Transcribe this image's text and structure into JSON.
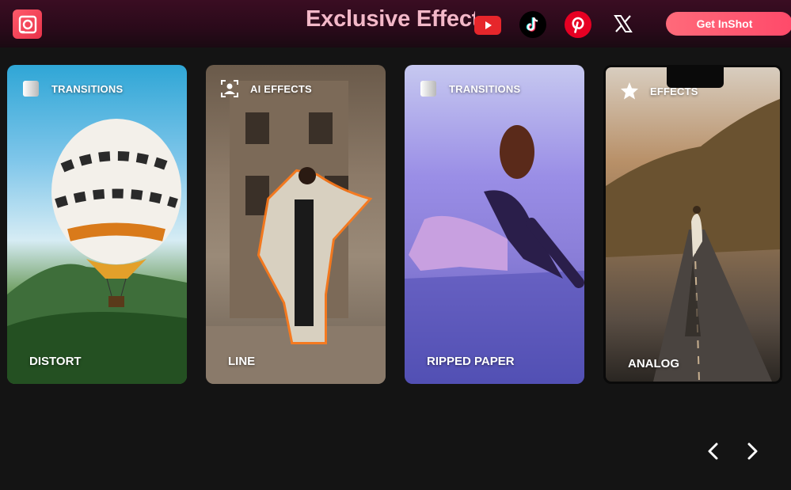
{
  "header": {
    "title": "Exclusive Effect",
    "cta_label": "Get InShot",
    "social": [
      "youtube-icon",
      "tiktok-icon",
      "pinterest-icon",
      "x-icon"
    ]
  },
  "cards": [
    {
      "category": "TRANSITIONS",
      "category_icon": "gradient-square-icon",
      "name": "DISTORT"
    },
    {
      "category": "AI EFFECTS",
      "category_icon": "person-frame-icon",
      "name": "LINE"
    },
    {
      "category": "TRANSITIONS",
      "category_icon": "gradient-square-icon",
      "name": "RIPPED PAPER"
    },
    {
      "category": "EFFECTS",
      "category_icon": "star-icon",
      "name": "ANALOG"
    }
  ],
  "colors": {
    "accent": "#ff5a6a",
    "background": "#141414",
    "title": "#f3b8c8"
  }
}
